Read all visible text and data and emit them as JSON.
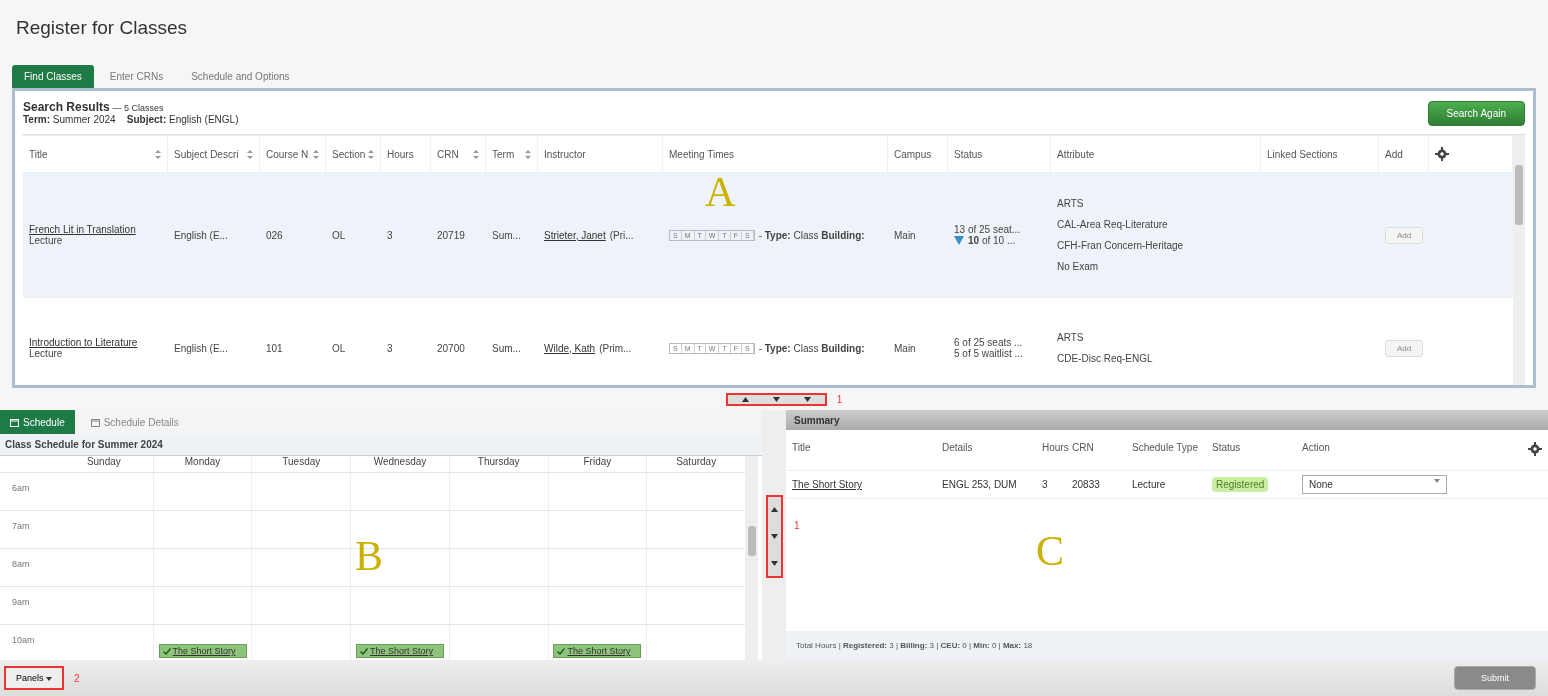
{
  "page_title": "Register for Classes",
  "tabs": [
    {
      "label": "Find Classes",
      "selected": true
    },
    {
      "label": "Enter CRNs",
      "selected": false
    },
    {
      "label": "Schedule and Options",
      "selected": false
    }
  ],
  "search": {
    "heading": "Search Results",
    "count": "— 5 Classes",
    "term_label": "Term:",
    "term": "Summer 2024",
    "subject_label": "Subject:",
    "subject": "English (ENGL)",
    "button": "Search Again",
    "annotation": "A",
    "columns": [
      {
        "label": "Title",
        "sortable": true
      },
      {
        "label": "Subject Descri",
        "sortable": true
      },
      {
        "label": "Course N",
        "sortable": true
      },
      {
        "label": "Section",
        "sortable": true
      },
      {
        "label": "Hours",
        "sortable": false
      },
      {
        "label": "CRN",
        "sortable": true
      },
      {
        "label": "Term",
        "sortable": true
      },
      {
        "label": "Instructor",
        "sortable": false
      },
      {
        "label": "Meeting Times",
        "sortable": false
      },
      {
        "label": "Campus",
        "sortable": false
      },
      {
        "label": "Status",
        "sortable": false
      },
      {
        "label": "Attribute",
        "sortable": false
      },
      {
        "label": "Linked Sections",
        "sortable": false
      },
      {
        "label": "Add",
        "sortable": false
      }
    ],
    "rows": [
      {
        "selected": true,
        "title": "French Lit in Translation",
        "schedule_type": "Lecture",
        "subject": "English (E...",
        "course": "026",
        "section": "OL",
        "hours": "3",
        "crn": "20719",
        "term": "Sum...",
        "instructor": "Strieter, Janet",
        "instructor_role": "(Pri...",
        "days": [
          "S",
          "M",
          "T",
          "W",
          "T",
          "F",
          "S"
        ],
        "meeting": "- **Type:** Class **Building:**",
        "campus": "Main",
        "status": [
          {
            "kind": "seats",
            "text": "13 of 25 seat..."
          },
          {
            "kind": "waitlist_full",
            "text": "**10** of 10 ..."
          }
        ],
        "attributes": [
          "ARTS",
          "CAL-Area Req-Literature",
          "CFH-Fran Concern-Heritage",
          "No Exam"
        ],
        "add": "Add",
        "add_disabled": true
      },
      {
        "selected": false,
        "title": "Introduction to Literature",
        "schedule_type": "Lecture",
        "subject": "English (E...",
        "course": "101",
        "section": "OL",
        "hours": "3",
        "crn": "20700",
        "term": "Sum...",
        "instructor": "Wilde, Kath",
        "instructor_role": "(Prim...",
        "days": [
          "S",
          "M",
          "T",
          "W",
          "T",
          "F",
          "S"
        ],
        "meeting": "- **Type:** Class **Building:**",
        "campus": "Main",
        "status": [
          {
            "kind": "seats",
            "text": "6 of 25 seats ..."
          },
          {
            "kind": "seats",
            "text": "5 of 5 waitlist ..."
          }
        ],
        "attributes": [
          "ARTS",
          "CDE-Disc Req-ENGL"
        ],
        "add": "Add",
        "add_disabled": true
      }
    ]
  },
  "splitter": {
    "marker": "1"
  },
  "schedule": {
    "tabs": [
      {
        "label": "Schedule",
        "selected": true
      },
      {
        "label": "Schedule Details",
        "selected": false
      }
    ],
    "heading": "Class Schedule for Summer 2024",
    "annotation": "B",
    "days": [
      "Sunday",
      "Monday",
      "Tuesday",
      "Wednesday",
      "Thursday",
      "Friday",
      "Saturday"
    ],
    "hours": [
      {
        "label": "6am"
      },
      {
        "label": "7am"
      },
      {
        "label": "8am"
      },
      {
        "label": "9am"
      },
      {
        "label": "10am",
        "cells": [
          {},
          {
            "event": "The Short Story"
          },
          {},
          {
            "event": "The Short Story"
          },
          {},
          {
            "event": "The Short Story"
          },
          {}
        ]
      }
    ]
  },
  "vsplitter": {
    "marker": "1"
  },
  "summary": {
    "heading": "Summary",
    "annotation": "C",
    "columns": [
      "Title",
      "Details",
      "Hours",
      "CRN",
      "Schedule Type",
      "Status",
      "Action"
    ],
    "rows": [
      {
        "title": "The Short Story",
        "details": "ENGL 253, DUM",
        "hours": "3",
        "crn": "20833",
        "schedule_type": "Lecture",
        "status": "Registered",
        "action": "None"
      }
    ],
    "footer": "Total Hours | **Registered:** 3 | **Billing:** 3 | **CEU:** 0 | **Min:** 0 | **Max:** 18"
  },
  "bottom": {
    "panels": "Panels",
    "marker": "2",
    "submit": "Submit",
    "submit_disabled": true
  }
}
